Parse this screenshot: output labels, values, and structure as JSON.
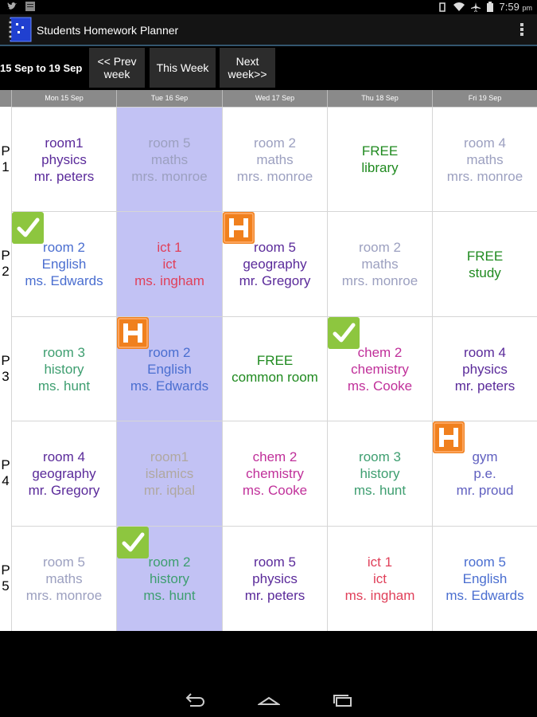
{
  "status": {
    "time": "7:59",
    "ampm": "pm"
  },
  "app": {
    "title": "Students Homework Planner"
  },
  "nav": {
    "range": "15 Sep to 19 Sep",
    "prev": "<< Prev\nweek",
    "this": "This Week",
    "next": "Next\nweek>>"
  },
  "days": [
    "Mon 15 Sep",
    "Tue 16 Sep",
    "Wed 17 Sep",
    "Thu 18 Sep",
    "Fri 19 Sep"
  ],
  "periods": [
    "P\n1",
    "P\n2",
    "P\n3",
    "P\n4",
    "P\n5"
  ],
  "highlight_day": 1,
  "colors": {
    "check": "#8dc63f",
    "homework": "#f0801e",
    "highlight": "#c2c2f4"
  },
  "timetable": [
    [
      {
        "lines": [
          "room1",
          "physics",
          "mr. peters"
        ],
        "color": "#5a2a9a"
      },
      {
        "lines": [
          "room 5",
          "maths",
          "mrs. monroe"
        ],
        "color": "#9ca0c0"
      },
      {
        "lines": [
          "room 2",
          "maths",
          "mrs. monroe"
        ],
        "color": "#9ca0c0"
      },
      {
        "lines": [
          "FREE",
          "library"
        ],
        "color": "#1f8a1f"
      },
      {
        "lines": [
          "room 4",
          "maths",
          "mrs. monroe"
        ],
        "color": "#9ca0c0"
      }
    ],
    [
      {
        "lines": [
          "room 2",
          "English",
          "ms. Edwards"
        ],
        "color": "#4a6ed0",
        "badge": "check"
      },
      {
        "lines": [
          "ict 1",
          "ict",
          "ms. ingham"
        ],
        "color": "#e0405a"
      },
      {
        "lines": [
          "room 5",
          "geography",
          "mr. Gregory"
        ],
        "color": "#5a2a9a",
        "badge": "homework"
      },
      {
        "lines": [
          "room 2",
          "maths",
          "mrs. monroe"
        ],
        "color": "#9ca0c0"
      },
      {
        "lines": [
          "FREE",
          "study"
        ],
        "color": "#1f8a1f"
      }
    ],
    [
      {
        "lines": [
          "room 3",
          "history",
          "ms. hunt"
        ],
        "color": "#3e9e70"
      },
      {
        "lines": [
          "room 2",
          "English",
          "ms. Edwards"
        ],
        "color": "#4a6ed0",
        "badge": "homework"
      },
      {
        "lines": [
          "FREE",
          "common room"
        ],
        "color": "#1f8a1f"
      },
      {
        "lines": [
          "chem 2",
          "chemistry",
          "ms. Cooke"
        ],
        "color": "#c0309a",
        "badge": "check"
      },
      {
        "lines": [
          "room 4",
          "physics",
          "mr. peters"
        ],
        "color": "#5a2a9a"
      }
    ],
    [
      {
        "lines": [
          "room 4",
          "geography",
          "mr. Gregory"
        ],
        "color": "#5a2a9a"
      },
      {
        "lines": [
          "room1",
          "islamics",
          "mr. iqbal"
        ],
        "color": "#b0a8a0"
      },
      {
        "lines": [
          "chem 2",
          "chemistry",
          "ms. Cooke"
        ],
        "color": "#c0309a"
      },
      {
        "lines": [
          "room 3",
          "history",
          "ms. hunt"
        ],
        "color": "#3e9e70"
      },
      {
        "lines": [
          "gym",
          "p.e.",
          "mr. proud"
        ],
        "color": "#6060c0",
        "badge": "homework"
      }
    ],
    [
      {
        "lines": [
          "room 5",
          "maths",
          "mrs. monroe"
        ],
        "color": "#9ca0c0"
      },
      {
        "lines": [
          "room 2",
          "history",
          "ms. hunt"
        ],
        "color": "#3e9e70",
        "badge": "check"
      },
      {
        "lines": [
          "room 5",
          "physics",
          "mr. peters"
        ],
        "color": "#5a2a9a"
      },
      {
        "lines": [
          "ict 1",
          "ict",
          "ms. ingham"
        ],
        "color": "#e0405a"
      },
      {
        "lines": [
          "room 5",
          "English",
          "ms. Edwards"
        ],
        "color": "#4a6ed0"
      }
    ]
  ]
}
